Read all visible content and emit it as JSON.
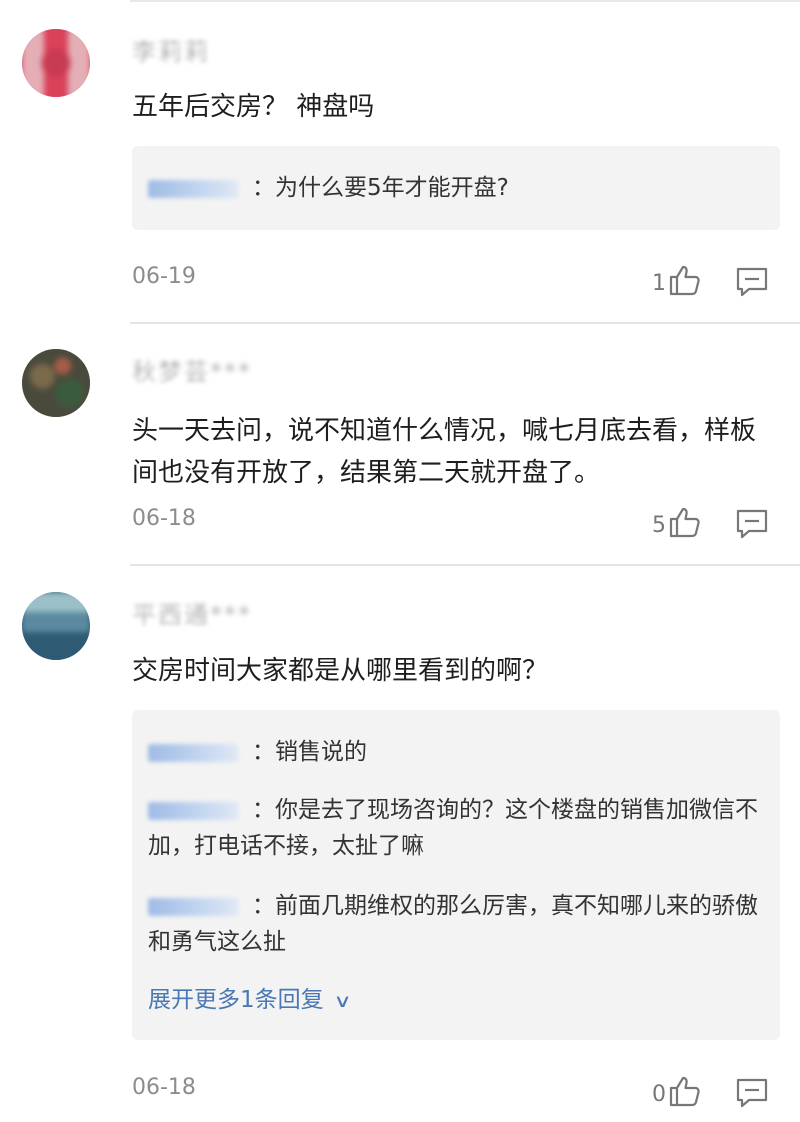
{
  "comments": [
    {
      "username": "李莉莉",
      "content": "五年后交房？ 神盘吗",
      "replies": [
        {
          "text": "：为什么要5年才能开盘?"
        }
      ],
      "date": "06-19",
      "likes": "1",
      "avatar_colors": [
        "#d9425a",
        "#c93b52",
        "#e4aeb6"
      ]
    },
    {
      "username": "秋梦芸***",
      "content": "头一天去问，说不知道什么情况，喊七月底去看，样板间也没有开放了，结果第二天就开盘了。",
      "replies": [],
      "date": "06-18",
      "likes": "5",
      "avatar_colors": [
        "#4a4a3c",
        "#7a6a4c",
        "#3b5b3e"
      ]
    },
    {
      "username": "平西通***",
      "content": "交房时间大家都是从哪里看到的啊？",
      "replies": [
        {
          "text": "：销售说的"
        },
        {
          "text": "：你是去了现场咨询的？这个楼盘的销售加微信不加，打电话不接，太扯了嘛"
        },
        {
          "text": "：前面几期维权的那么厉害，真不知哪儿来的骄傲和勇气这么扯"
        }
      ],
      "expand_label": "展开更多1条回复",
      "date": "06-18",
      "likes": "0",
      "avatar_colors": [
        "#2f5a73",
        "#5b8aa0",
        "#9cc0c9"
      ]
    }
  ],
  "icons": {
    "like": "thumbs-up-icon",
    "reply": "comment-icon",
    "expand": "chevron-down-icon"
  },
  "colors": {
    "link": "#4a78b5",
    "meta": "#8c8c8c",
    "reply_bg": "#f3f3f3"
  }
}
